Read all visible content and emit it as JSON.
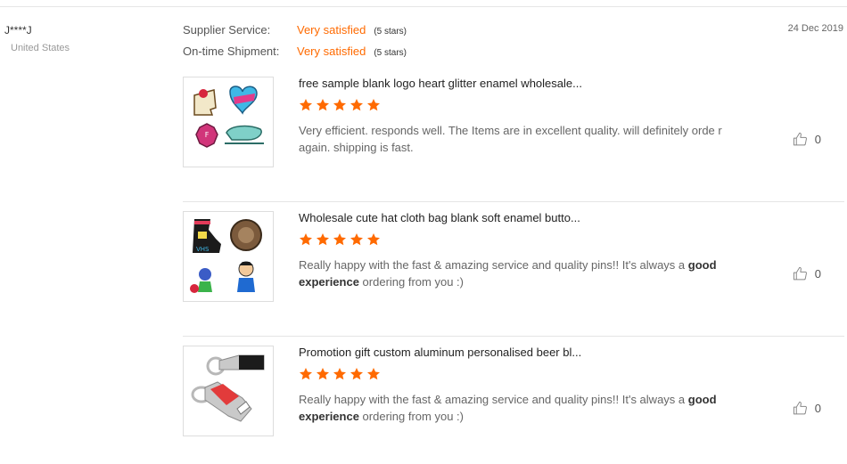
{
  "reviewer": {
    "name": "J****J",
    "country": "United States"
  },
  "date": "24 Dec 2019",
  "ratings": [
    {
      "label": "Supplier Service:",
      "value": "Very satisfied",
      "stars": "(5 stars)"
    },
    {
      "label": "On-time Shipment:",
      "value": "Very satisfied",
      "stars": "(5 stars)"
    }
  ],
  "colors": {
    "accent": "#ff6a00",
    "star": "#ff6a00",
    "divider": "#e5e5e5"
  },
  "icons": {
    "star": "star-icon",
    "like": "thumbs-up-icon"
  },
  "reviews": [
    {
      "title": "free sample blank logo heart glitter enamel wholesale...",
      "rating": 5,
      "text": "Very efficient. responds well. The Items are in excellent quality. will definitely orde r again. shipping is fast.",
      "text_bold_1": "",
      "text_end": "",
      "likes": "0"
    },
    {
      "title": "Wholesale cute hat cloth bag blank soft enamel butto...",
      "rating": 5,
      "text": "Really happy with the fast & amazing service and quality pins!! It's always a ",
      "text_bold_1": "good experience",
      "text_end": " ordering from you :)",
      "likes": "0"
    },
    {
      "title": "Promotion gift custom aluminum personalised beer bl...",
      "rating": 5,
      "text": "Really happy with the fast & amazing service and quality pins!! It's always a ",
      "text_bold_1": "good experience",
      "text_end": " ordering from you :)",
      "likes": "0"
    }
  ]
}
